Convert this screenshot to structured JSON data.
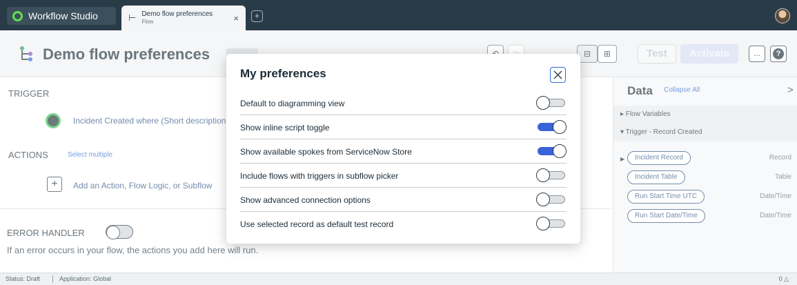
{
  "topbar": {
    "brand": "Workflow Studio",
    "tab": {
      "title": "Demo flow preferences",
      "subtitle": "Flow",
      "close": "×"
    },
    "new_tab": "+"
  },
  "header": {
    "title": "Demo flow preferences",
    "test_label": "Test",
    "activate_label": "Activate",
    "more_label": "...",
    "help_label": "?"
  },
  "main": {
    "trigger_heading": "TRIGGER",
    "trigger_text": "Incident Created where (Short description",
    "actions_heading": "ACTIONS",
    "select_multiple": "Select multiple",
    "add_icon": "+",
    "add_text": "Add an Action, Flow Logic, or Subflow",
    "error_heading": "ERROR HANDLER",
    "error_toggle_on": false,
    "error_description": "If an error occurs in your flow, the actions you add here will run."
  },
  "data_panel": {
    "title": "Data",
    "collapse_all": "Collapse All",
    "chevron": ">",
    "flow_variables": "▸ Flow Variables",
    "trigger_section": "▾ Trigger - Record Created",
    "pills": [
      {
        "label": "Incident Record",
        "type": "Record"
      },
      {
        "label": "Incident Table",
        "type": "Table"
      },
      {
        "label": "Run Start Time UTC",
        "type": "Date/Time"
      },
      {
        "label": "Run Start Date/Time",
        "type": "Date/Time"
      }
    ]
  },
  "statusbar": {
    "status": "Status: Draft",
    "application": "Application: Global",
    "right": "0 △"
  },
  "modal": {
    "title": "My preferences",
    "preferences": [
      {
        "label": "Default to diagramming view",
        "on": false
      },
      {
        "label": "Show inline script toggle",
        "on": true
      },
      {
        "label": "Show available spokes from ServiceNow Store",
        "on": true
      },
      {
        "label": "Include flows with triggers in subflow picker",
        "on": false
      },
      {
        "label": "Show advanced connection options",
        "on": false
      },
      {
        "label": "Use selected record as default test record",
        "on": false
      }
    ]
  },
  "colors": {
    "topbar": "#2a3b48",
    "accent_blue": "#3b63d8",
    "brand_green": "#63df4e"
  }
}
